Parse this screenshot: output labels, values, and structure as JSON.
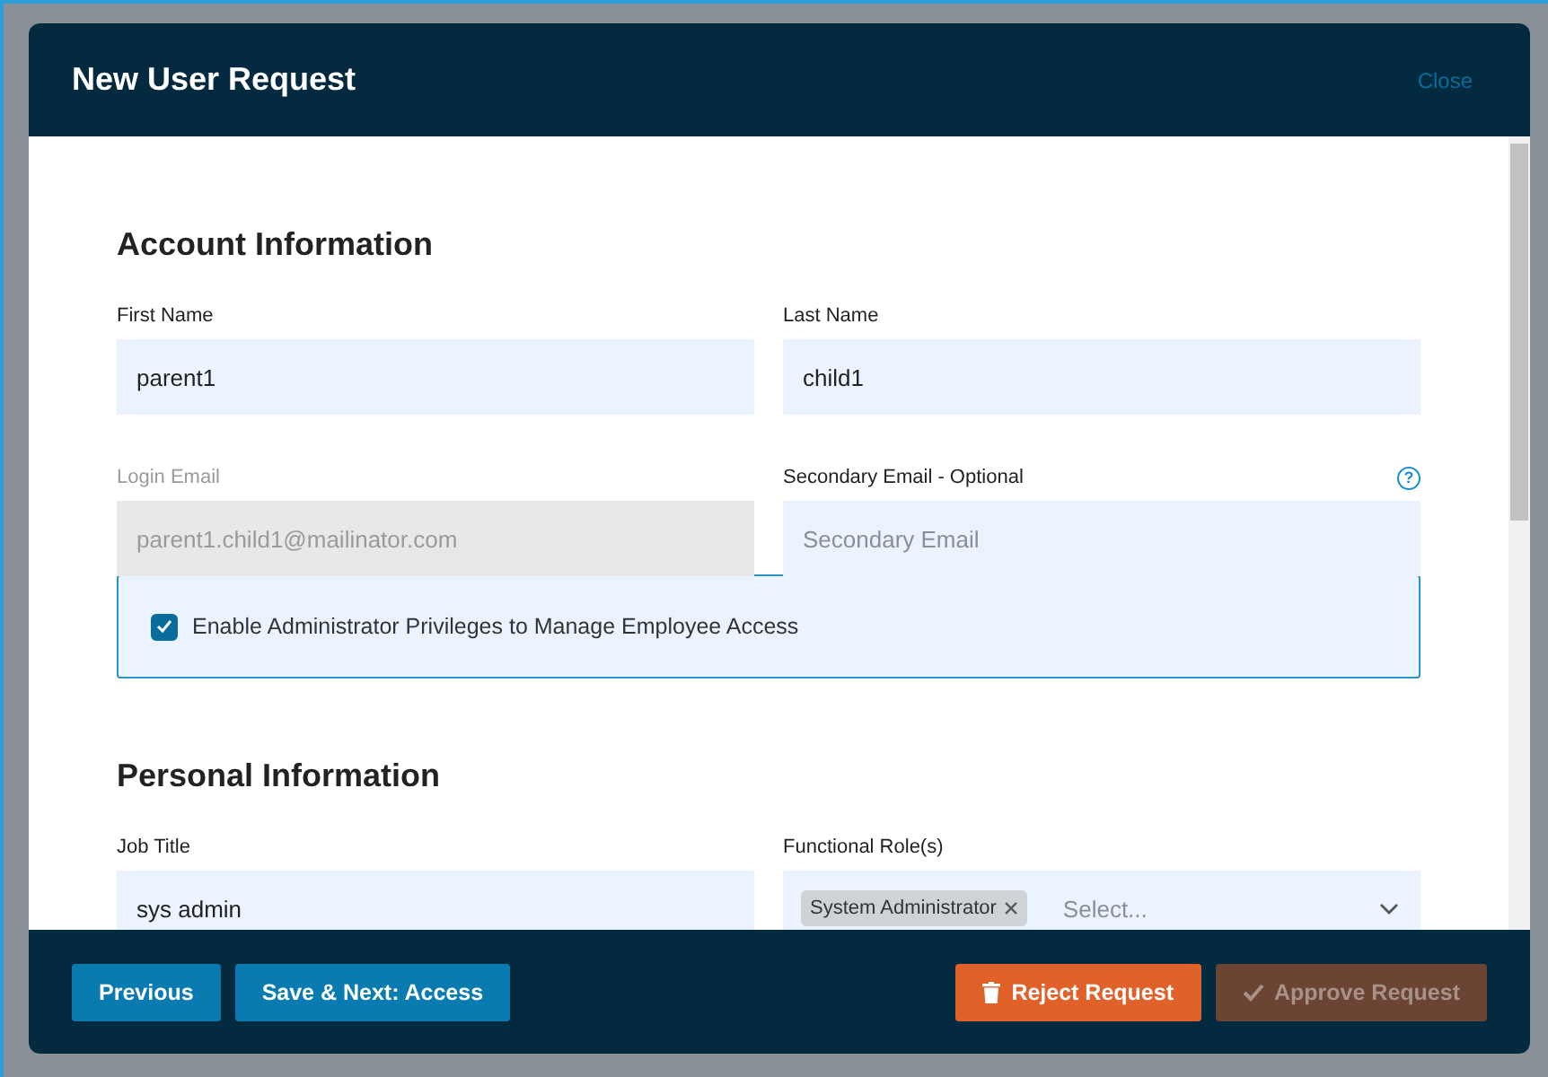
{
  "dialog": {
    "title": "New User Request",
    "close_label": "Close"
  },
  "sections": [
    {
      "title": "Account Information",
      "fields": [
        {
          "kind": "text",
          "label": "First Name",
          "value": "parent1",
          "disabled": false
        },
        {
          "kind": "text",
          "label": "Last Name",
          "value": "child1",
          "disabled": false
        },
        {
          "kind": "text",
          "label": "Login Email",
          "value": "parent1.child1@mailinator.com",
          "disabled": true
        },
        {
          "kind": "text",
          "label": "Secondary Email - Optional",
          "placeholder": "Secondary Email",
          "disabled": false,
          "help": "?"
        }
      ],
      "option": {
        "label": "Enable Administrator Privileges to Manage Employee Access",
        "checked": true
      }
    },
    {
      "title": "Personal Information",
      "fields": [
        {
          "kind": "text",
          "label": "Job Title",
          "value": "sys admin",
          "disabled": false
        },
        {
          "kind": "multiselect",
          "label": "Functional Role(s)",
          "tags": [
            "System Administrator"
          ],
          "placeholder": "Select...",
          "disabled": false
        }
      ]
    }
  ],
  "footer": {
    "left": [
      {
        "label": "Previous",
        "kind": "primary",
        "disabled": false
      },
      {
        "label": "Save & Next: Access",
        "kind": "primary",
        "disabled": false
      }
    ],
    "right": [
      {
        "label": "Reject Request",
        "kind": "danger",
        "disabled": false
      },
      {
        "label": "Approve Request",
        "kind": "approve",
        "disabled": true
      }
    ]
  }
}
